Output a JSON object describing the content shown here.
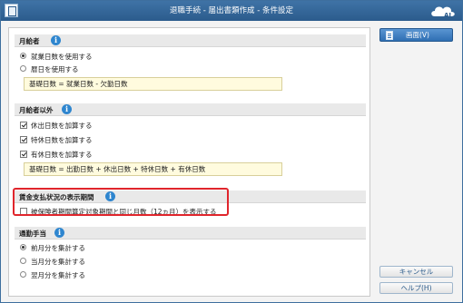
{
  "window": {
    "title": "退職手続 - 届出書類作成 - 条件設定"
  },
  "sections": {
    "monthly": {
      "title": "月給者",
      "options": [
        {
          "label": "就業日数を使用する",
          "selected": true
        },
        {
          "label": "暦日を使用する",
          "selected": false
        }
      ],
      "formula": "基礎日数 = 就業日数 - 欠勤日数"
    },
    "non_monthly": {
      "title": "月給者以外",
      "options": [
        {
          "label": "休出日数を加算する",
          "checked": true
        },
        {
          "label": "特休日数を加算する",
          "checked": true
        },
        {
          "label": "有休日数を加算する",
          "checked": true
        }
      ],
      "formula": "基礎日数 = 出勤日数 + 休出日数 + 特休日数 + 有休日数"
    },
    "wage_period": {
      "title": "賃金支払状況の表示期間",
      "option": {
        "label": "被保険者期間算定対象期間と同じ月数（12ヵ月）を表示する",
        "checked": false
      },
      "highlight_color": "#e0252c"
    },
    "commute": {
      "title": "通勤手当",
      "options": [
        {
          "label": "前月分を集計する",
          "selected": true
        },
        {
          "label": "当月分を集計する",
          "selected": false
        },
        {
          "label": "翌月分を集計する",
          "selected": false
        }
      ]
    }
  },
  "buttons": {
    "preview": "画面(V)",
    "cancel": "キャンセル",
    "help": "ヘルプ(H)"
  },
  "icons": {
    "info": "i",
    "brand": "AI"
  },
  "colors": {
    "titlebar": "#2b5b8c",
    "accent": "#2f6fb3",
    "formula_bg": "#fffbde"
  }
}
